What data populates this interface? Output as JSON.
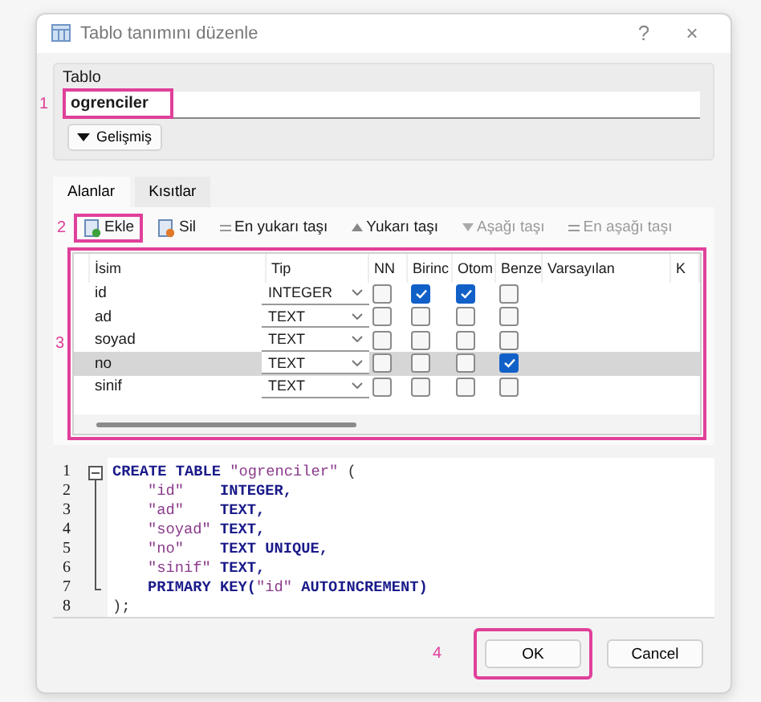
{
  "window": {
    "title": "Tablo tanımını düzenle",
    "help": "?",
    "close": "×"
  },
  "table_group": {
    "label": "Tablo",
    "name_value": "ogrenciler",
    "name_callout": "1",
    "advanced_button": "Gelişmiş"
  },
  "tabs": [
    {
      "label": "Alanlar",
      "selected": true
    },
    {
      "label": "Kısıtlar",
      "selected": false
    }
  ],
  "toolbar": {
    "callout": "2",
    "items": [
      {
        "label": "Ekle",
        "kind": "add",
        "disabled": false,
        "highlighted": true
      },
      {
        "label": "Sil",
        "kind": "remove",
        "disabled": false,
        "highlighted": false
      },
      {
        "label": "En yukarı taşı",
        "kind": "top",
        "disabled": false,
        "highlighted": false
      },
      {
        "label": "Yukarı taşı",
        "kind": "up",
        "disabled": false,
        "highlighted": false
      },
      {
        "label": "Aşağı taşı",
        "kind": "down",
        "disabled": true,
        "highlighted": false
      },
      {
        "label": "En aşağı taşı",
        "kind": "bottom",
        "disabled": true,
        "highlighted": false
      }
    ]
  },
  "fields": {
    "callout": "3",
    "columns": [
      "İsim",
      "Tip",
      "NN",
      "Birinc",
      "Otom",
      "Benze",
      "Varsayılan",
      "K"
    ],
    "rows": [
      {
        "name": "id",
        "type": "INTEGER",
        "nn": false,
        "pk": true,
        "ai": true,
        "unique": false,
        "selected": false
      },
      {
        "name": "ad",
        "type": "TEXT",
        "nn": false,
        "pk": false,
        "ai": false,
        "unique": false,
        "selected": false
      },
      {
        "name": "soyad",
        "type": "TEXT",
        "nn": false,
        "pk": false,
        "ai": false,
        "unique": false,
        "selected": false
      },
      {
        "name": "no",
        "type": "TEXT",
        "nn": false,
        "pk": false,
        "ai": false,
        "unique": true,
        "selected": true
      },
      {
        "name": "sinif",
        "type": "TEXT",
        "nn": false,
        "pk": false,
        "ai": false,
        "unique": false,
        "selected": false
      }
    ]
  },
  "sql": {
    "lines": [
      {
        "number": "1",
        "indented": false,
        "tokens": [
          {
            "text": "CREATE TABLE ",
            "kind": "keyword"
          },
          {
            "text": "\"ogrenciler\"",
            "kind": "string"
          },
          {
            "text": " (",
            "kind": "plain"
          }
        ]
      },
      {
        "number": "2",
        "indented": true,
        "tokens": [
          {
            "text": "\"id\"",
            "kind": "string"
          },
          {
            "text": "    INTEGER,",
            "kind": "keyword"
          }
        ]
      },
      {
        "number": "3",
        "indented": true,
        "tokens": [
          {
            "text": "\"ad\"",
            "kind": "string"
          },
          {
            "text": "    TEXT,",
            "kind": "keyword"
          }
        ]
      },
      {
        "number": "4",
        "indented": true,
        "tokens": [
          {
            "text": "\"soyad\"",
            "kind": "string"
          },
          {
            "text": " TEXT,",
            "kind": "keyword"
          }
        ]
      },
      {
        "number": "5",
        "indented": true,
        "tokens": [
          {
            "text": "\"no\"",
            "kind": "string"
          },
          {
            "text": "    TEXT UNIQUE,",
            "kind": "keyword"
          }
        ]
      },
      {
        "number": "6",
        "indented": true,
        "tokens": [
          {
            "text": "\"sinif\"",
            "kind": "string"
          },
          {
            "text": " TEXT,",
            "kind": "keyword"
          }
        ]
      },
      {
        "number": "7",
        "indented": true,
        "tokens": [
          {
            "text": "PRIMARY KEY(",
            "kind": "keyword"
          },
          {
            "text": "\"id\"",
            "kind": "string"
          },
          {
            "text": " AUTOINCREMENT)",
            "kind": "keyword"
          }
        ]
      },
      {
        "number": "8",
        "indented": false,
        "tokens": [
          {
            "text": ");",
            "kind": "plain"
          }
        ]
      }
    ]
  },
  "buttons": {
    "callout": "4",
    "items": [
      {
        "label": "OK",
        "highlighted": true
      },
      {
        "label": "Cancel",
        "highlighted": false
      }
    ]
  }
}
